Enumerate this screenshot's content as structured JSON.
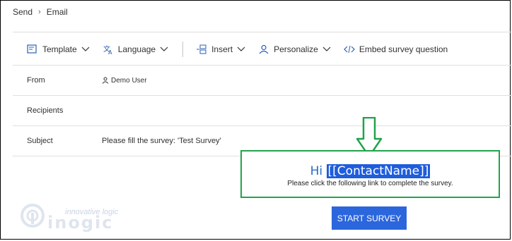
{
  "breadcrumb": {
    "parent": "Send",
    "current": "Email"
  },
  "toolbar": {
    "template": "Template",
    "language": "Language",
    "insert": "Insert",
    "personalize": "Personalize",
    "embed": "Embed survey question"
  },
  "form": {
    "from_label": "From",
    "from_value": "Demo User",
    "recipients_label": "Recipients",
    "subject_label": "Subject",
    "subject_value": "Please fill the survey: 'Test Survey'"
  },
  "email_body": {
    "greeting": "Hi",
    "placeholder": "[[ContactName]]",
    "message": "Please click the following link to complete the survey.",
    "button_label": "START SURVEY"
  },
  "watermark": {
    "tagline": "innovative logic",
    "wordmark": "inogic"
  },
  "colors": {
    "accent_blue": "#2b66dd",
    "highlight_green": "#22a34a",
    "selection": "#1e5ddc"
  },
  "icons": {
    "template": "template-icon",
    "language": "language-icon",
    "insert": "insert-icon",
    "personalize": "person-icon",
    "embed": "code-icon"
  }
}
